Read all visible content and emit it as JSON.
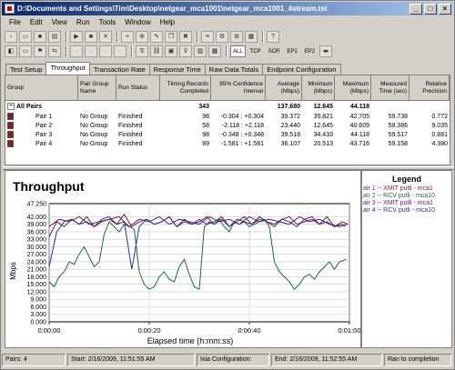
{
  "window": {
    "title": "D:\\Documents and Settings\\Tim\\Desktop\\netgear_mca1001\\netgear_mca1001_4stream.tst"
  },
  "menu": [
    "File",
    "Edit",
    "View",
    "Run",
    "Tools",
    "Window",
    "Help"
  ],
  "toolbar": {
    "stat_buttons": [
      "ALL",
      "TCP",
      "SCR",
      "EP1",
      "EP2"
    ]
  },
  "tabs": [
    "Test Setup",
    "Throughput",
    "Transaction Rate",
    "Response Time",
    "Raw Data Totals",
    "Endpoint Configuration"
  ],
  "active_tab": 1,
  "grid": {
    "columns": [
      "Group",
      "Pair Group Name",
      "Run Status",
      "Timing Records Completed",
      "95% Confidence Interval",
      "Average (Mbps)",
      "Minimum (Mbps)",
      "Maximum (Mbps)",
      "Measured Time (sec)",
      "Relative Precision"
    ],
    "all": {
      "label": "All Pairs",
      "records": "343",
      "average": "137.680",
      "minimum": "12.645",
      "maximum": "44.118"
    },
    "rows": [
      {
        "pair": "Pair 1",
        "group": "No Group",
        "status": "Finished",
        "records": "98",
        "ci": "-0.304 : +0.304",
        "avg": "39.372",
        "min": "35.821",
        "max": "42.705",
        "time": "59.738",
        "prec": "0.772"
      },
      {
        "pair": "Pair 2",
        "group": "No Group",
        "status": "Finished",
        "records": "58",
        "ci": "-2.118 : +2.118",
        "avg": "23.440",
        "min": "12.645",
        "max": "40.609",
        "time": "59.386",
        "prec": "9.035"
      },
      {
        "pair": "Pair 3",
        "group": "No Group",
        "status": "Finished",
        "records": "98",
        "ci": "-0.348 : +0.348",
        "avg": "39.518",
        "min": "34.433",
        "max": "44.118",
        "time": "59.517",
        "prec": "0.881"
      },
      {
        "pair": "Pair 4",
        "group": "No Group",
        "status": "Finished",
        "records": "89",
        "ci": "-1.581 : +1.581",
        "avg": "36.107",
        "min": "20.513",
        "max": "43.716",
        "time": "59.158",
        "prec": "4.380"
      }
    ]
  },
  "legend": {
    "title": "Legend",
    "items": [
      {
        "text": "air 1 -- XMIT  putli - mca1",
        "color": "#8b1a1a"
      },
      {
        "text": "air 2 -- RCV  putli - mca10",
        "color": "#1a6b3a"
      },
      {
        "text": "air 3 -- XMIT  putli - mca1",
        "color": "#5a0f8a"
      },
      {
        "text": "air 4 -- RCV  putli - mca10",
        "color": "#1f3a8a"
      }
    ]
  },
  "chart_data": {
    "type": "line",
    "title": "Throughput",
    "xlabel": "Elapsed time (h:mm:ss)",
    "ylabel": "Mbps",
    "xlim": [
      0,
      60
    ],
    "ylim": [
      0,
      47.25
    ],
    "x_ticks": [
      "0:00:00",
      "0:00:20",
      "0:00:40",
      "0:01:00"
    ],
    "y_ticks": [
      "0.000",
      "3.000",
      "6.000",
      "9.000",
      "12.000",
      "15.000",
      "18.000",
      "21.000",
      "24.000",
      "27.000",
      "30.000",
      "33.000",
      "36.000",
      "39.000",
      "42.000",
      "47.250"
    ],
    "grid": true,
    "series": [
      {
        "color": "#8b1a1a",
        "x": [
          0,
          1.5,
          3,
          4.5,
          6,
          7.5,
          9,
          10.5,
          12,
          13.5,
          15,
          16.5,
          18,
          19.5,
          21,
          22.5,
          24,
          25.5,
          27,
          28.5,
          30,
          31.5,
          33,
          34.5,
          36,
          37.5,
          39,
          40.5,
          42,
          43.5,
          45,
          46.5,
          48,
          49.5,
          51,
          52.5,
          54,
          55.5,
          57,
          58.5,
          59.7
        ],
        "y": [
          34,
          40,
          38,
          41,
          39,
          42,
          38,
          40,
          41,
          39,
          43,
          38,
          40,
          41,
          39,
          40,
          42,
          38,
          41,
          39,
          40,
          42,
          39,
          41,
          38,
          40,
          42,
          39,
          41,
          40,
          38,
          41,
          42,
          39,
          40,
          41,
          39,
          42,
          38,
          40,
          39
        ]
      },
      {
        "color": "#1a6b3a",
        "x": [
          0,
          1,
          2,
          3,
          4,
          5,
          6,
          7,
          8,
          9,
          10,
          11,
          12,
          13,
          14,
          15,
          16,
          17,
          18,
          19,
          20,
          21,
          22,
          23,
          24,
          25,
          26,
          27,
          28,
          29,
          30,
          31,
          32,
          33,
          34,
          35,
          36,
          37,
          38,
          39,
          40,
          41,
          42,
          43,
          44,
          45,
          46,
          47,
          48,
          49,
          50,
          51,
          52,
          53,
          54,
          55,
          56,
          57,
          58,
          59.4
        ],
        "y": [
          16,
          14,
          18,
          20,
          24,
          23,
          27,
          30,
          26,
          22,
          24,
          35,
          40,
          38,
          36,
          39,
          38,
          37,
          20,
          15,
          13,
          14,
          18,
          20,
          17,
          16,
          22,
          25,
          19,
          14,
          13,
          38,
          40,
          39,
          41,
          38,
          36,
          40,
          39,
          40,
          38,
          39,
          40,
          41,
          38,
          24,
          20,
          18,
          16,
          13,
          15,
          18,
          19,
          17,
          20,
          22,
          24,
          21,
          24,
          25
        ]
      },
      {
        "color": "#5a0f8a",
        "x": [
          0,
          2,
          4,
          6,
          8,
          10,
          12,
          14,
          16,
          18,
          20,
          22,
          24,
          26,
          28,
          30,
          32,
          34,
          36,
          38,
          40,
          42,
          44,
          46,
          48,
          50,
          52,
          54,
          56,
          58,
          59.5
        ],
        "y": [
          38,
          41,
          40,
          42,
          39,
          40,
          41,
          42,
          38,
          41,
          40,
          42,
          39,
          41,
          40,
          39,
          42,
          40,
          41,
          39,
          42,
          40,
          41,
          40,
          39,
          42,
          40,
          41,
          39,
          38,
          39
        ]
      },
      {
        "color": "#1f3a8a",
        "x": [
          0,
          1.5,
          3,
          4.5,
          6,
          7.5,
          9,
          10.5,
          12,
          13.5,
          15,
          16.5,
          18,
          19.5,
          21,
          22.5,
          24,
          25.5,
          27,
          28.5,
          30,
          31.5,
          33,
          34.5,
          36,
          37.5,
          39,
          40.5,
          42,
          43.5,
          45,
          46.5,
          48,
          49.5,
          51,
          52.5,
          54,
          55.5,
          57,
          58.5,
          59.2
        ],
        "y": [
          22,
          36,
          40,
          41,
          39,
          40,
          38,
          41,
          42,
          39,
          40,
          21,
          38,
          41,
          39,
          40,
          42,
          38,
          40,
          39,
          41,
          39,
          40,
          42,
          38,
          41,
          40,
          39,
          42,
          40,
          39,
          41,
          40,
          38,
          41,
          42,
          39,
          40,
          38,
          39,
          38
        ]
      }
    ]
  },
  "status": {
    "pairs": "Pairs: 4",
    "start": "Start: 2/16/2009, 11:51:55 AM",
    "ixia": "Ixia Configuration:",
    "end": "End: 2/16/2009, 11:52:55 AM",
    "run": "Ran to completion"
  }
}
